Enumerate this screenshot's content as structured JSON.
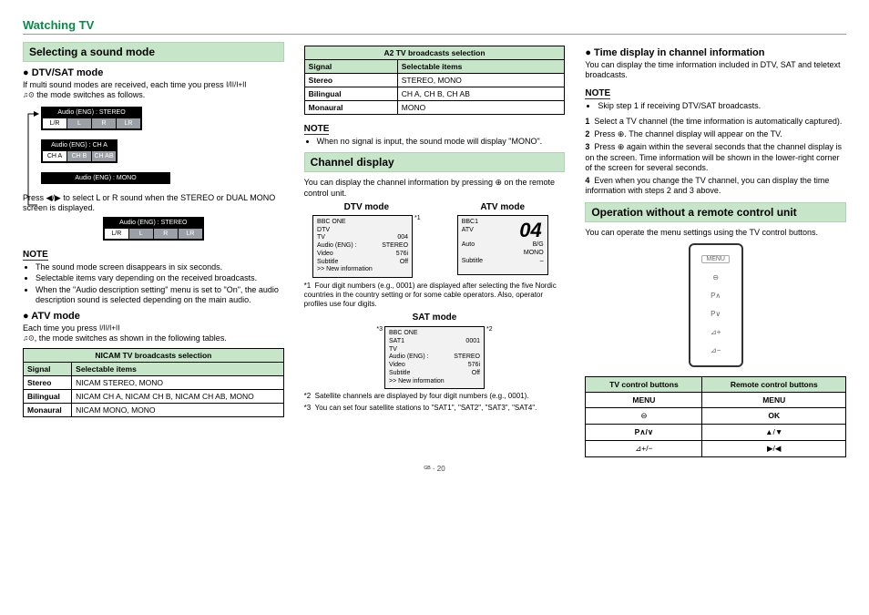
{
  "page_title": "Watching TV",
  "footer": "ᴳᴮ · 20",
  "col1": {
    "bar1": "Selecting a sound mode",
    "h1": "DTV/SAT mode",
    "p1a": "If multi sound modes are received, each time you press ",
    "p1b": " the mode switches as follows.",
    "dia": {
      "r1_label": "Audio (ENG)  :  STEREO",
      "r1_cells": [
        "L/R",
        "L",
        "R",
        "LR"
      ],
      "r2_label": "Audio (ENG)  :  CH A",
      "r2_cells": [
        "CH A",
        "CH B",
        "CH AB"
      ],
      "r3_label": "Audio (ENG)  :  MONO"
    },
    "p2": "Press ◀/▶ to select L or R sound when the STEREO or DUAL MONO screen is displayed.",
    "dia2": {
      "label": "Audio (ENG) : STEREO",
      "cells": [
        "L/R",
        "L",
        "R",
        "LR"
      ]
    },
    "note1_head": "NOTE",
    "note1": [
      "The sound mode screen disappears in six seconds.",
      "Selectable items vary depending on the received broadcasts.",
      "When the \"Audio description setting\" menu is set to \"On\", the audio description sound is selected depending on the main audio."
    ],
    "h2": "ATV mode",
    "p3a": "Each time you press ",
    "p3b": ", the mode switches as shown in the following tables.",
    "nicam": {
      "title": "NICAM TV broadcasts selection",
      "cols": [
        "Signal",
        "Selectable items"
      ],
      "rows": [
        [
          "Stereo",
          "NICAM STEREO, MONO"
        ],
        [
          "Bilingual",
          "NICAM CH A, NICAM CH B, NICAM CH AB, MONO"
        ],
        [
          "Monaural",
          "NICAM MONO, MONO"
        ]
      ]
    }
  },
  "col2": {
    "a2": {
      "title": "A2 TV broadcasts selection",
      "cols": [
        "Signal",
        "Selectable items"
      ],
      "rows": [
        [
          "Stereo",
          "STEREO, MONO"
        ],
        [
          "Bilingual",
          "CH A, CH B, CH AB"
        ],
        [
          "Monaural",
          "MONO"
        ]
      ]
    },
    "note_head": "NOTE",
    "note": [
      "When no signal is input, the sound mode will display \"MONO\"."
    ],
    "bar2": "Channel display",
    "p1": "You can display the channel information by pressing ⊕ on the remote control unit.",
    "dtv_title": "DTV mode",
    "atv_title": "ATV mode",
    "sat_title": "SAT mode",
    "dtv": {
      "l1": "BBC ONE",
      "l2a": "DTV",
      "l2b": "",
      "l3a": "TV",
      "l3b": "004",
      "l4a": "Audio (ENG)  :",
      "l4b": "STEREO",
      "l5a": "Video",
      "l5b": "576i",
      "l6a": "Subtitle",
      "l6b": "Off",
      "l7": ">> New information"
    },
    "atv": {
      "l1": "BBC1",
      "l2": "ATV",
      "big": "04",
      "l3a": "Auto",
      "l3b": "B/G",
      "l3c": "MONO",
      "l4a": "Subtitle",
      "l4b": "–"
    },
    "sat": {
      "l1": "BBC ONE",
      "l2a": "SAT1",
      "l2b": "0001",
      "l3a": "TV",
      "l4a": "Audio (ENG)  :",
      "l4b": "STEREO",
      "l5a": "Video",
      "l5b": "576i",
      "l6a": "Subtitle",
      "l6b": "Off",
      "l7": ">> New information"
    },
    "star1": "Four digit numbers (e.g., 0001) are displayed after selecting the five Nordic countries in the country setting or for some cable operators. Also, operator profiles use four digits.",
    "star2": "Satellite channels are displayed by four digit numbers (e.g., 0001).",
    "star3": "You can set four satellite stations to \"SAT1\", \"SAT2\", \"SAT3\", \"SAT4\"."
  },
  "col3": {
    "h1": "Time display in channel information",
    "p1": "You can display the time information included in DTV, SAT and teletext broadcasts.",
    "note_head": "NOTE",
    "note": [
      "Skip step 1 if receiving DTV/SAT broadcasts."
    ],
    "steps": [
      "Select a TV channel (the time information is automatically captured).",
      "Press ⊕. The channel display will appear on the TV.",
      "Press ⊕ again within the several seconds that the channel display is on the screen. Time information will be shown in the lower-right corner of the screen for several seconds.",
      "Even when you change the TV channel, you can display the time information with steps 2 and 3 above."
    ],
    "bar": "Operation without a remote control unit",
    "p2": "You can operate the menu settings using the TV control buttons.",
    "panel": [
      "MENU",
      "⊖",
      "P∧",
      "P∨",
      "⊿+",
      "⊿−"
    ],
    "controls": {
      "head": [
        "TV control buttons",
        "Remote control buttons"
      ],
      "rows": [
        [
          "MENU",
          "MENU"
        ],
        [
          "⊖",
          "OK"
        ],
        [
          "P∧/∨",
          "▲/▼"
        ],
        [
          "⊿+/−",
          "▶/◀"
        ]
      ]
    }
  }
}
